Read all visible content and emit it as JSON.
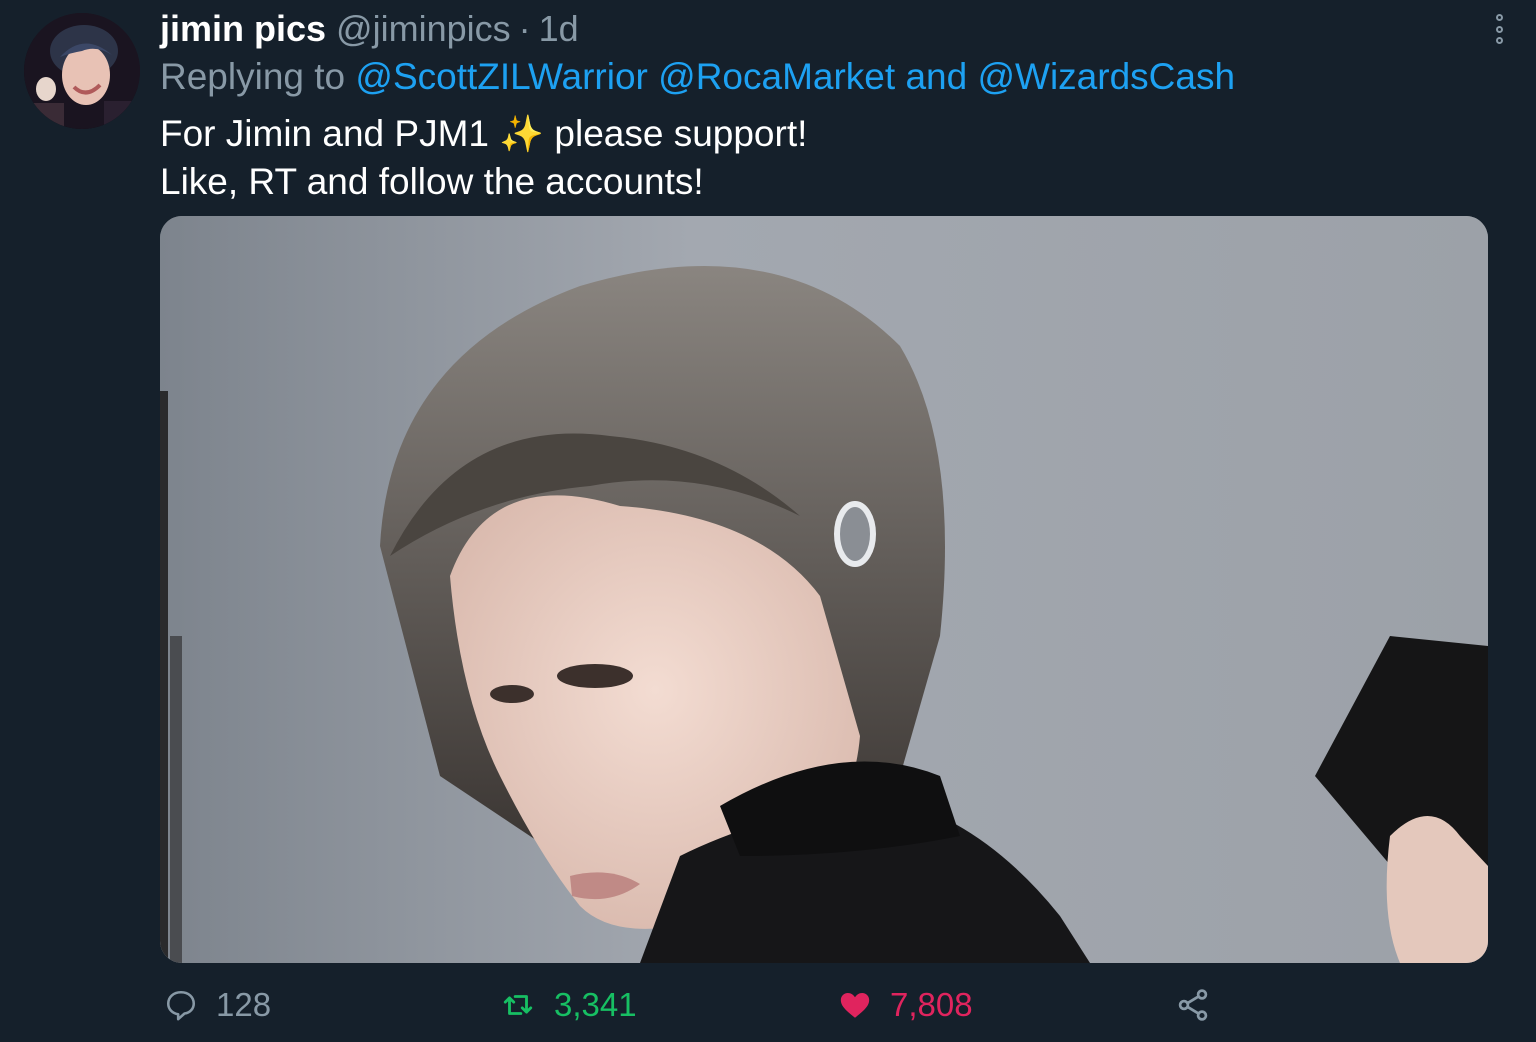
{
  "tweet": {
    "display_name": "jimin pics",
    "handle": "@jiminpics",
    "separator": "·",
    "time": "1d",
    "avatar_icon": "avatar-photo",
    "more_icon": "more-options-icon"
  },
  "reply": {
    "prefix": "Replying to",
    "mentions": [
      "@ScottZILWarrior",
      "@RocaMarket"
    ],
    "conjunction": "and",
    "last_mention": "@WizardsCash"
  },
  "text": {
    "line1_before": "For Jimin and PJM1",
    "emoji": "✨",
    "line1_after": "please support!",
    "line2": "Like, RT and follow the accounts!"
  },
  "media": {
    "type": "photo"
  },
  "actions": {
    "replies": "128",
    "retweets": "3,341",
    "likes": "7,808"
  },
  "colors": {
    "background": "#15202b",
    "secondary_text": "#8899a6",
    "link": "#1da1f2",
    "retweet": "#17bf63",
    "like": "#e0245e"
  }
}
